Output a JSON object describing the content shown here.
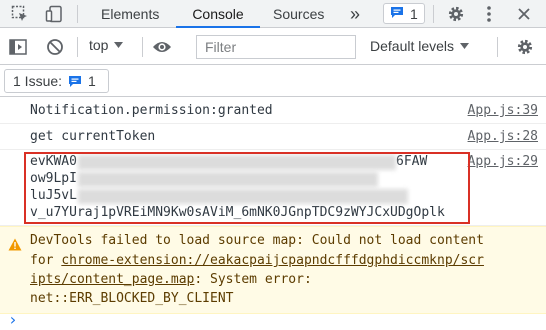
{
  "tabs": {
    "elements": "Elements",
    "console": "Console",
    "sources": "Sources",
    "more": "»"
  },
  "header_badge": {
    "count": "1"
  },
  "toolbar": {
    "context": "top",
    "filter_placeholder": "Filter",
    "levels": "Default levels"
  },
  "issues": {
    "label": "1 Issue:",
    "count": "1"
  },
  "messages": [
    {
      "text": "Notification.permission:granted",
      "source": "App.js:39"
    },
    {
      "text": "get currentToken",
      "source": "App.js:28"
    }
  ],
  "token_message": {
    "source": "App.js:29",
    "line1_start": "evKWA0",
    "line1_end": "6FAW",
    "line2_start": "ow9LpI",
    "line3_start": "luJ5vL",
    "line4": "v_u7YUraj1pVREiMN9Kw0sAViM_6mNK0JGnpTDC9zWYJCxUDgOplk"
  },
  "warning": {
    "line1": "DevTools failed to load source map: Could not load content",
    "line2_prefix": "for ",
    "line2_link": "chrome-extension://eakacpaijcpapndcfffdgphdiccmknp/scr",
    "line3_link": "ipts/content_page.map",
    "line3_suffix": ": System error:",
    "line4": "net::ERR_BLOCKED_BY_CLIENT"
  },
  "prompt": "›",
  "colors": {
    "accent": "#1a73e8",
    "highlight_box": "#d93025",
    "warning_bg": "#fffbe6"
  }
}
